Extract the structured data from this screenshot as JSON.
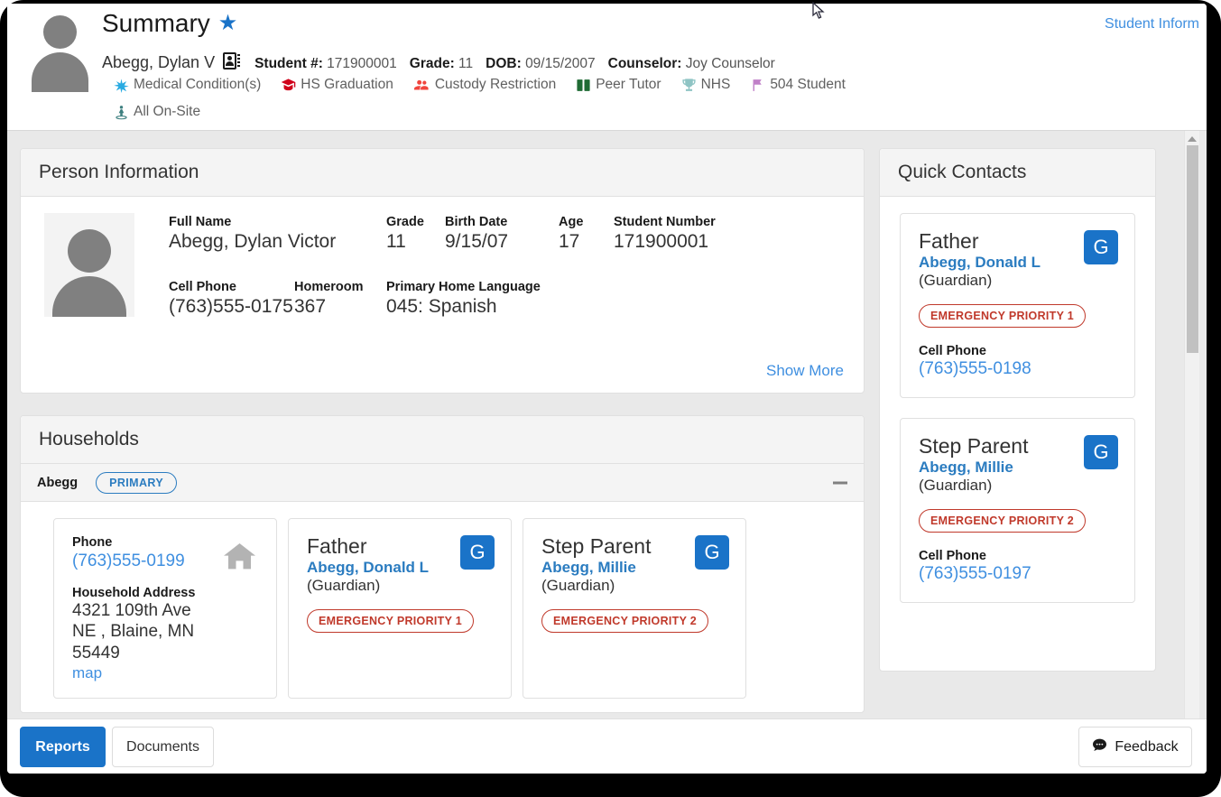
{
  "header": {
    "title": "Summary",
    "favorite_icon": "star-icon",
    "student_name": "Abegg, Dylan V",
    "contact_card_icon": "contact-card-icon",
    "meta": [
      {
        "label": "Student #:",
        "value": "171900001"
      },
      {
        "label": "Grade:",
        "value": "11"
      },
      {
        "label": "DOB:",
        "value": "09/15/2007"
      },
      {
        "label": "Counselor:",
        "value": "Joy Counselor"
      }
    ],
    "flags_row1": [
      {
        "icon": "asterisk-icon",
        "label": "Medical Condition(s)",
        "color": "#29abe2"
      },
      {
        "icon": "graduation-cap-icon",
        "label": "HS Graduation",
        "color": "#d0021b"
      },
      {
        "icon": "people-icon",
        "label": "Custody Restriction",
        "color": "#f1453d"
      },
      {
        "icon": "book-icon",
        "label": "Peer Tutor",
        "color": "#1f6b34"
      },
      {
        "icon": "trophy-icon",
        "label": "NHS",
        "color": "#8fc4c4"
      },
      {
        "icon": "flag-icon",
        "label": "504 Student",
        "color": "#c080c8"
      }
    ],
    "flags_row2": [
      {
        "icon": "person-location-icon",
        "label": "All On-Site",
        "color": "#3d7f7f"
      }
    ],
    "student_information_link": "Student Inform"
  },
  "person_information": {
    "title": "Person Information",
    "photo_icon": "person-photo-placeholder",
    "fields": [
      {
        "label": "Full Name",
        "value": "Abegg, Dylan Victor"
      },
      {
        "label": "Grade",
        "value": "11"
      },
      {
        "label": "Birth Date",
        "value": "9/15/07"
      },
      {
        "label": "Age",
        "value": "17"
      },
      {
        "label": "Student Number",
        "value": "171900001"
      },
      {
        "label": "Cell Phone",
        "value": "(763)555-0175"
      },
      {
        "label": "Homeroom",
        "value": "367"
      },
      {
        "label": "Primary Home Language",
        "value": "045: Spanish"
      }
    ],
    "show_more": "Show More"
  },
  "households": {
    "title": "Households",
    "household_name": "Abegg",
    "primary_badge": "PRIMARY",
    "collapse_icon": "minus-icon",
    "address_card": {
      "phone_label": "Phone",
      "phone_value": "(763)555-0199",
      "address_label": "Household Address",
      "address_line1": "4321 109th Ave",
      "address_line2": "NE , Blaine, MN",
      "address_line3": "55449",
      "map_link": "map",
      "house_icon": "house-icon"
    },
    "members": [
      {
        "relation": "Father",
        "person": "Abegg, Donald L",
        "guardian_text": "(Guardian)",
        "guardian_badge": "G",
        "emergency_pill": "EMERGENCY PRIORITY 1"
      },
      {
        "relation": "Step Parent",
        "person": "Abegg, Millie",
        "guardian_text": "(Guardian)",
        "guardian_badge": "G",
        "emergency_pill": "EMERGENCY PRIORITY 2"
      }
    ]
  },
  "quick_contacts": {
    "title": "Quick Contacts",
    "contacts": [
      {
        "relation": "Father",
        "person": "Abegg, Donald L",
        "guardian_text": "(Guardian)",
        "guardian_badge": "G",
        "emergency_pill": "EMERGENCY PRIORITY 1",
        "phone_label": "Cell Phone",
        "phone_value": "(763)555-0198"
      },
      {
        "relation": "Step Parent",
        "person": "Abegg, Millie",
        "guardian_text": "(Guardian)",
        "guardian_badge": "G",
        "emergency_pill": "EMERGENCY PRIORITY 2",
        "phone_label": "Cell Phone",
        "phone_value": "(763)555-0197"
      }
    ]
  },
  "toolbar": {
    "reports_label": "Reports",
    "documents_label": "Documents",
    "feedback_label": "Feedback",
    "feedback_icon": "comment-icon"
  },
  "annotation": {
    "highlight_color": "#f4483f"
  },
  "accent_colors": {
    "primary_blue": "#1a73c8",
    "link_blue": "#3f8fe0",
    "emergency_red": "#c0392b"
  }
}
